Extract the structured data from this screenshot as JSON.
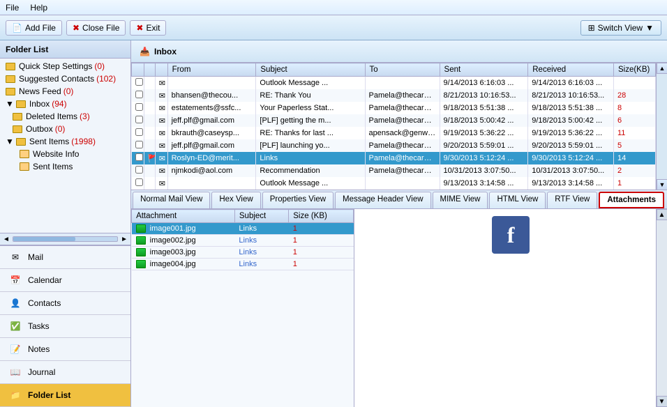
{
  "menu": {
    "file": "File",
    "help": "Help"
  },
  "toolbar": {
    "add_file": "Add File",
    "close_file": "Close File",
    "exit": "Exit",
    "switch_view": "Switch View"
  },
  "sidebar": {
    "title": "Folder List",
    "folders": [
      {
        "label": "Quick Step Settings",
        "badge": "(0)",
        "indent": 0,
        "icon": "folder"
      },
      {
        "label": "Suggested Contacts",
        "badge": "(102)",
        "indent": 0,
        "icon": "folder"
      },
      {
        "label": "News Feed",
        "badge": "(0)",
        "indent": 0,
        "icon": "folder"
      },
      {
        "label": "Inbox",
        "badge": "(94)",
        "indent": 0,
        "icon": "folder"
      },
      {
        "label": "Deleted Items",
        "badge": "(3)",
        "indent": 1,
        "icon": "folder"
      },
      {
        "label": "Outbox",
        "badge": "(0)",
        "indent": 1,
        "icon": "folder"
      },
      {
        "label": "Sent Items",
        "badge": "(1998)",
        "indent": 0,
        "icon": "folder"
      },
      {
        "label": "Website Info",
        "indent": 2,
        "icon": "file"
      },
      {
        "label": "Sent Items",
        "indent": 2,
        "icon": "file"
      }
    ]
  },
  "nav_buttons": [
    {
      "label": "Mail",
      "icon": "mail",
      "active": false
    },
    {
      "label": "Calendar",
      "icon": "calendar",
      "active": false
    },
    {
      "label": "Contacts",
      "icon": "contacts",
      "active": false
    },
    {
      "label": "Tasks",
      "icon": "tasks",
      "active": false
    },
    {
      "label": "Notes",
      "icon": "notes",
      "active": false
    },
    {
      "label": "Journal",
      "icon": "journal",
      "active": false
    },
    {
      "label": "Folder List",
      "icon": "folder-list",
      "active": true
    }
  ],
  "inbox": {
    "title": "Inbox",
    "columns": [
      "",
      "",
      "",
      "From",
      "Subject",
      "To",
      "Sent",
      "Received",
      "Size(KB)"
    ],
    "rows": [
      {
        "check": "",
        "flag": "",
        "icon": "📧",
        "from": "",
        "subject": "Outlook Message ...",
        "to": "",
        "sent": "9/14/2013 6:16:03 ...",
        "received": "9/14/2013 6:16:03 ...",
        "size": "",
        "selected": false
      },
      {
        "check": "",
        "flag": "",
        "icon": "📧",
        "from": "bhansen@thecou...",
        "subject": "RE: Thank You",
        "to": "Pamela@thecaren...",
        "sent": "8/21/2013 10:16:53...",
        "received": "8/21/2013 10:16:53...",
        "size": "28",
        "selected": false
      },
      {
        "check": "",
        "flag": "",
        "icon": "📧",
        "from": "estatements@ssfc...",
        "subject": "Your Paperless Stat...",
        "to": "Pamela@thecaren...",
        "sent": "9/18/2013 5:51:38 ...",
        "received": "9/18/2013 5:51:38 ...",
        "size": "8",
        "selected": false
      },
      {
        "check": "",
        "flag": "",
        "icon": "📧",
        "from": "jeff.plf@gmail.com",
        "subject": "[PLF] getting the m...",
        "to": "Pamela@thecaren...",
        "sent": "9/18/2013 5:00:42 ...",
        "received": "9/18/2013 5:00:42 ...",
        "size": "6",
        "selected": false
      },
      {
        "check": "",
        "flag": "",
        "icon": "📧",
        "from": "bkrauth@caseysp...",
        "subject": "RE: Thanks for last ...",
        "to": "apensack@genwo...",
        "sent": "9/19/2013 5:36:22 ...",
        "received": "9/19/2013 5:36:22 ...",
        "size": "11",
        "selected": false
      },
      {
        "check": "",
        "flag": "",
        "icon": "📧",
        "from": "jeff.plf@gmail.com",
        "subject": "[PLF] launching yo...",
        "to": "Pamela@thecaren...",
        "sent": "9/20/2013 5:59:01 ...",
        "received": "9/20/2013 5:59:01 ...",
        "size": "5",
        "selected": false
      },
      {
        "check": "",
        "flag": "🚩",
        "icon": "📧",
        "from": "Roslyn-ED@merit...",
        "subject": "Links",
        "to": "Pamela@thecaren...",
        "sent": "9/30/2013 5:12:24 ...",
        "received": "9/30/2013 5:12:24 ...",
        "size": "14",
        "selected": true
      },
      {
        "check": "",
        "flag": "",
        "icon": "📧",
        "from": "njmkodi@aol.com",
        "subject": "Recommendation",
        "to": "Pamela@thecaren...",
        "sent": "10/31/2013 3:07:50...",
        "received": "10/31/2013 3:07:50...",
        "size": "2",
        "selected": false
      },
      {
        "check": "",
        "flag": "",
        "icon": "📧",
        "from": "",
        "subject": "Outlook Message ...",
        "to": "",
        "sent": "9/13/2013 3:14:58 ...",
        "received": "9/13/2013 3:14:58 ...",
        "size": "1",
        "selected": false
      }
    ]
  },
  "view_tabs": [
    {
      "label": "Normal Mail View",
      "active": false
    },
    {
      "label": "Hex View",
      "active": false
    },
    {
      "label": "Properties View",
      "active": false
    },
    {
      "label": "Message Header View",
      "active": false
    },
    {
      "label": "MIME View",
      "active": false
    },
    {
      "label": "HTML View",
      "active": false
    },
    {
      "label": "RTF View",
      "active": false
    },
    {
      "label": "Attachments",
      "active": false,
      "highlighted": true
    }
  ],
  "attachments": {
    "columns": [
      "Attachment",
      "Subject",
      "Size (KB)"
    ],
    "rows": [
      {
        "name": "image001.jpg",
        "subject": "Links",
        "size": "1",
        "selected": true
      },
      {
        "name": "image002.jpg",
        "subject": "Links",
        "size": "1",
        "selected": false
      },
      {
        "name": "image003.jpg",
        "subject": "Links",
        "size": "1",
        "selected": false
      },
      {
        "name": "image004.jpg",
        "subject": "Links",
        "size": "1",
        "selected": false
      }
    ]
  }
}
